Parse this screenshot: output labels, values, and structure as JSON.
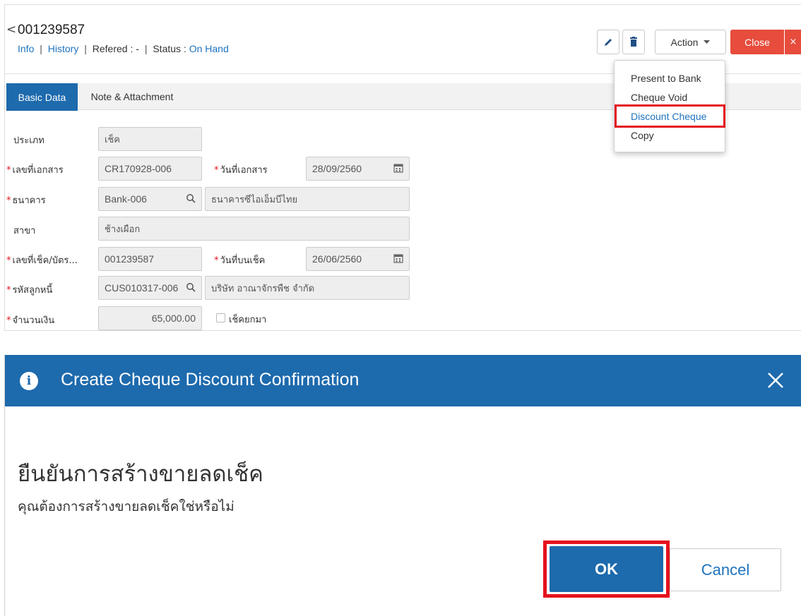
{
  "header": {
    "back_glyph": "<",
    "doc_number": "001239587",
    "info_link": "Info",
    "history_link": "History",
    "referred_label": "Refered",
    "referred_value": "-",
    "status_label": "Status",
    "status_value": "On Hand",
    "separator": "|",
    "colon": ":"
  },
  "toolbar": {
    "edit_icon": "pencil-icon",
    "delete_icon": "trash-icon",
    "action_label": "Action",
    "close_label": "Close",
    "close_x": "×"
  },
  "action_menu": {
    "items": [
      "Present to Bank",
      "Cheque Void",
      "Discount Cheque",
      "Copy"
    ],
    "highlighted": "Discount Cheque"
  },
  "tabs": {
    "basic": "Basic Data",
    "notes": "Note & Attachment"
  },
  "form": {
    "type": {
      "label": "ประเภท",
      "value": "เช็ค"
    },
    "doc_no": {
      "label": "เลขที่เอกสาร",
      "value": "CR170928-006"
    },
    "doc_date": {
      "label": "วันที่เอกสาร",
      "value": "28/09/2560"
    },
    "bank": {
      "label": "ธนาคาร",
      "code": "Bank-006",
      "name": "ธนาคารซีไอเอ็มบีไทย"
    },
    "branch": {
      "label": "สาขา",
      "value": "ช้างเผือก"
    },
    "cheque_no": {
      "label": "เลขที่เช็ค/บัตร...",
      "value": "001239587"
    },
    "cheque_date": {
      "label": "วันที่บนเช็ค",
      "value": "26/06/2560"
    },
    "debtor": {
      "label": "รหัสลูกหนี้",
      "code": "CUS010317-006",
      "name": "บริษัท อาณาจักรพืช จำกัด"
    },
    "amount": {
      "label": "จำนวนเงิน",
      "value": "65,000.00"
    },
    "bounced": {
      "label": "เช็คยกมา",
      "checked": false
    },
    "required_mark": "*"
  },
  "modal": {
    "title": "Create Cheque Discount Confirmation",
    "info_glyph": "i",
    "heading": "ยืนยันการสร้างขายลดเช็ค",
    "message": "คุณต้องการสร้างขายลดเช็คใช่หรือไม่",
    "ok_label": "OK",
    "cancel_label": "Cancel"
  },
  "colors": {
    "primary": "#1d6aad",
    "link": "#1e73be",
    "danger": "#e74c3c",
    "highlight_box": "#e5121d"
  }
}
